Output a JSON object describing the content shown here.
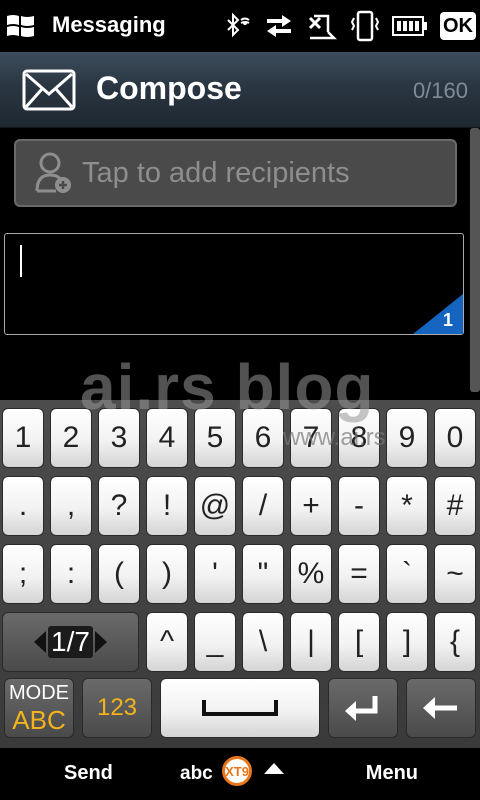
{
  "status_bar": {
    "app_title": "Messaging",
    "icons": [
      "bluetooth-icon",
      "data-sync-icon",
      "no-signal-icon",
      "vibrate-icon",
      "battery-icon"
    ],
    "ok_label": "OK"
  },
  "header": {
    "title": "Compose",
    "counter": "0/160",
    "icon": "envelope-icon"
  },
  "recipients": {
    "placeholder": "Tap to add recipients",
    "icon": "add-person-icon"
  },
  "message": {
    "value": "",
    "page_indicator": "1"
  },
  "watermark": {
    "main": "ai.rs blog",
    "sub": "www.ai.rs"
  },
  "keyboard": {
    "row1": [
      "1",
      "2",
      "3",
      "4",
      "5",
      "6",
      "7",
      "8",
      "9",
      "0"
    ],
    "row2": [
      ".",
      ",",
      "?",
      "!",
      "@",
      "/",
      "+",
      "-",
      "*",
      "#"
    ],
    "row3": [
      ";",
      ":",
      "(",
      ")",
      "'",
      "\"",
      "%",
      "=",
      "`",
      "~"
    ],
    "row4_page": "1/7",
    "row4": [
      "^",
      "_",
      "\\",
      "|",
      "[",
      "]",
      "{"
    ],
    "mode_top": "MODE",
    "mode_bottom": "ABC",
    "num_label": "123",
    "enter_icon": "enter-icon",
    "backspace_icon": "backspace-icon",
    "accent_color": "#f3b31b"
  },
  "softkeys": {
    "left": "Send",
    "center_text": "abc",
    "center_badge": "XT9",
    "right": "Menu"
  }
}
